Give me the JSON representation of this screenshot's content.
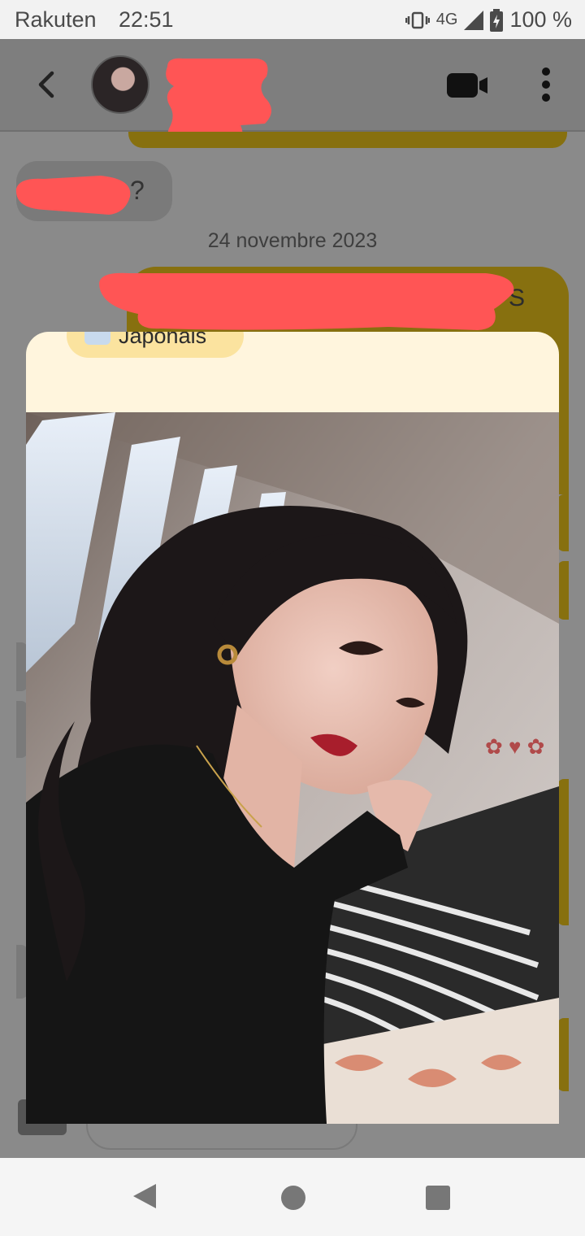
{
  "status_bar": {
    "carrier": "Rakuten",
    "time": "22:51",
    "network": "4G",
    "battery": "100 %"
  },
  "header": {
    "avatar_icon": "contact-avatar",
    "name_redacted": true,
    "video_icon": "video-camera-icon",
    "menu_icon": "more-vertical-icon"
  },
  "chat": {
    "incoming_fragment": "?",
    "date_separator": "24 novembre 2023",
    "outgoing_fragment": "S"
  },
  "profile_card": {
    "language_chip": "Japonais",
    "language_icon": "speech-bubble-icon"
  },
  "nav": {
    "back_icon": "nav-back-icon",
    "home_icon": "nav-home-icon",
    "recents_icon": "nav-recents-icon"
  },
  "colors": {
    "accent": "#ffc629",
    "accent_dimmed": "#87700f",
    "card_background": "#fff5dd",
    "chip_background": "#fbe39f",
    "redaction": "#ff5555"
  }
}
